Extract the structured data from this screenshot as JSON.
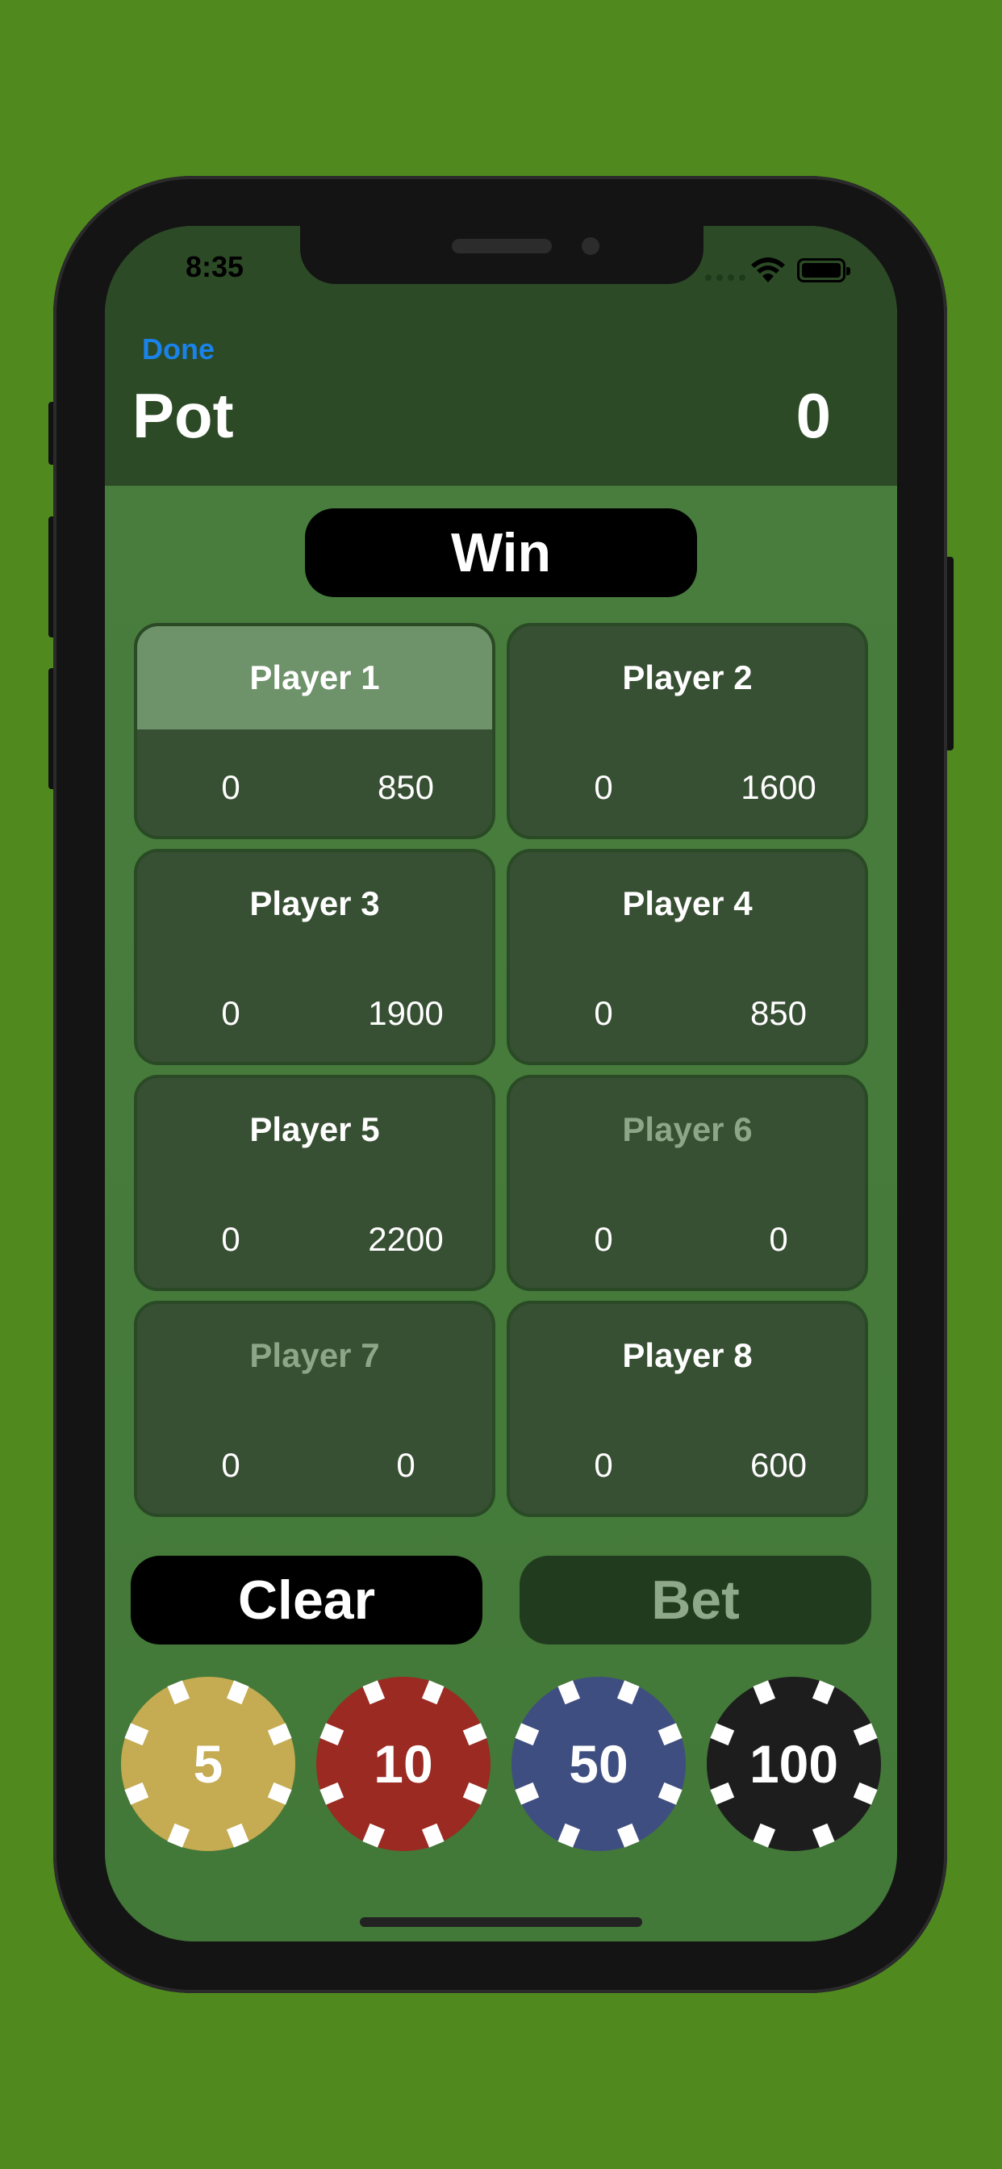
{
  "status_bar": {
    "time": "8:35"
  },
  "nav": {
    "done_label": "Done",
    "pot_label": "Pot",
    "pot_value": "0"
  },
  "actions": {
    "win_label": "Win",
    "clear_label": "Clear",
    "bet_label": "Bet"
  },
  "players": [
    {
      "name": "Player 1",
      "bet": "0",
      "stack": "850"
    },
    {
      "name": "Player 2",
      "bet": "0",
      "stack": "1600"
    },
    {
      "name": "Player 3",
      "bet": "0",
      "stack": "1900"
    },
    {
      "name": "Player 4",
      "bet": "0",
      "stack": "850"
    },
    {
      "name": "Player 5",
      "bet": "0",
      "stack": "2200"
    },
    {
      "name": "Player 6",
      "bet": "0",
      "stack": "0"
    },
    {
      "name": "Player 7",
      "bet": "0",
      "stack": "0"
    },
    {
      "name": "Player 8",
      "bet": "0",
      "stack": "600"
    }
  ],
  "chips": [
    {
      "value": "5",
      "color": "#c5ab52"
    },
    {
      "value": "10",
      "color": "#9a2a22"
    },
    {
      "value": "50",
      "color": "#3f4e80"
    },
    {
      "value": "100",
      "color": "#1d1d1d"
    }
  ],
  "colors": {
    "background": "#508a1f",
    "header": "#2c4a26",
    "card": "#374f32",
    "selected_card_header": "#6e926a",
    "link": "#1a82e8"
  }
}
